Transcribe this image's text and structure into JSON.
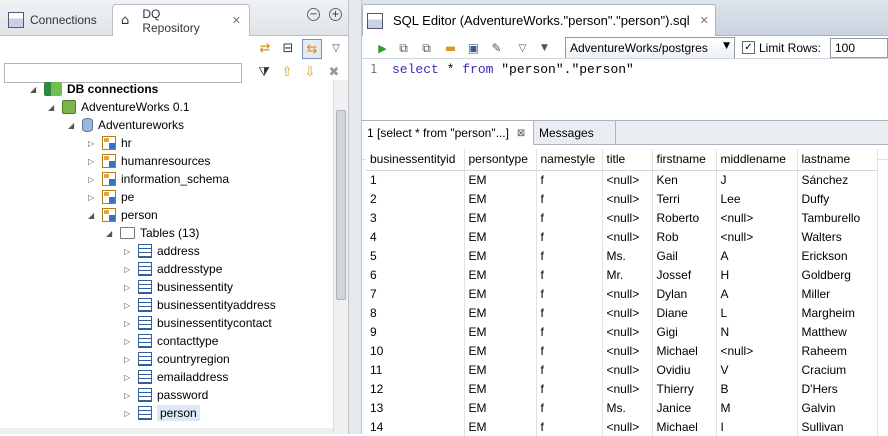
{
  "left_panel": {
    "tabs": [
      {
        "label": "Connections",
        "active": false
      },
      {
        "label": "DQ Repository",
        "active": true
      }
    ],
    "tree": [
      {
        "label": "DB connections",
        "level": 0,
        "icon": "db-connections-icon",
        "expanded": true,
        "bold": true
      },
      {
        "label": "AdventureWorks 0.1",
        "level": 1,
        "icon": "connection-icon",
        "expanded": true
      },
      {
        "label": "Adventureworks",
        "level": 2,
        "icon": "database-icon",
        "expanded": true
      },
      {
        "label": "hr",
        "level": 3,
        "icon": "schema-icon",
        "expanded": false
      },
      {
        "label": "humanresources",
        "level": 3,
        "icon": "schema-icon",
        "expanded": false
      },
      {
        "label": "information_schema",
        "level": 3,
        "icon": "schema-icon",
        "expanded": false
      },
      {
        "label": "pe",
        "level": 3,
        "icon": "schema-icon",
        "expanded": false
      },
      {
        "label": "person",
        "level": 3,
        "icon": "schema-icon",
        "expanded": true
      },
      {
        "label": "Tables (13)",
        "level": 4,
        "icon": "folder-icon",
        "expanded": true
      },
      {
        "label": "address",
        "level": 5,
        "icon": "table-icon",
        "expanded": false
      },
      {
        "label": "addresstype",
        "level": 5,
        "icon": "table-icon",
        "expanded": false
      },
      {
        "label": "businessentity",
        "level": 5,
        "icon": "table-icon",
        "expanded": false
      },
      {
        "label": "businessentityaddress",
        "level": 5,
        "icon": "table-icon",
        "expanded": false
      },
      {
        "label": "businessentitycontact",
        "level": 5,
        "icon": "table-icon",
        "expanded": false
      },
      {
        "label": "contacttype",
        "level": 5,
        "icon": "table-icon",
        "expanded": false
      },
      {
        "label": "countryregion",
        "level": 5,
        "icon": "table-icon",
        "expanded": false
      },
      {
        "label": "emailaddress",
        "level": 5,
        "icon": "table-icon",
        "expanded": false
      },
      {
        "label": "password",
        "level": 5,
        "icon": "table-icon",
        "expanded": false
      },
      {
        "label": "person",
        "level": 5,
        "icon": "table-icon",
        "expanded": false,
        "selected": true
      }
    ]
  },
  "editor": {
    "tab_title": "SQL Editor (AdventureWorks.\"person\".\"person\").sql",
    "connection": "AdventureWorks/postgres",
    "limit_rows_label": "Limit Rows:",
    "limit_rows_checked": true,
    "limit_rows_value": "100",
    "line_number": "1",
    "sql_keyword1": "select",
    "sql_mid": " * ",
    "sql_keyword2": "from",
    "sql_rest": " \"person\".\"person\""
  },
  "results": {
    "tabs": [
      {
        "label": "1 [select * from \"person\"...]",
        "active": true
      },
      {
        "label": "Messages",
        "active": false
      }
    ],
    "columns": [
      "businessentityid",
      "persontype",
      "namestyle",
      "title",
      "firstname",
      "middlename",
      "lastname"
    ],
    "rows": [
      [
        "1",
        "EM",
        "f",
        "<null>",
        "Ken",
        "J",
        "Sánchez"
      ],
      [
        "2",
        "EM",
        "f",
        "<null>",
        "Terri",
        "Lee",
        "Duffy"
      ],
      [
        "3",
        "EM",
        "f",
        "<null>",
        "Roberto",
        "<null>",
        "Tamburello"
      ],
      [
        "4",
        "EM",
        "f",
        "<null>",
        "Rob",
        "<null>",
        "Walters"
      ],
      [
        "5",
        "EM",
        "f",
        "Ms.",
        "Gail",
        "A",
        "Erickson"
      ],
      [
        "6",
        "EM",
        "f",
        "Mr.",
        "Jossef",
        "H",
        "Goldberg"
      ],
      [
        "7",
        "EM",
        "f",
        "<null>",
        "Dylan",
        "A",
        "Miller"
      ],
      [
        "8",
        "EM",
        "f",
        "<null>",
        "Diane",
        "L",
        "Margheim"
      ],
      [
        "9",
        "EM",
        "f",
        "<null>",
        "Gigi",
        "N",
        "Matthew"
      ],
      [
        "10",
        "EM",
        "f",
        "<null>",
        "Michael",
        "<null>",
        "Raheem"
      ],
      [
        "11",
        "EM",
        "f",
        "<null>",
        "Ovidiu",
        "V",
        "Cracium"
      ],
      [
        "12",
        "EM",
        "f",
        "<null>",
        "Thierry",
        "B",
        "D'Hers"
      ],
      [
        "13",
        "EM",
        "f",
        "Ms.",
        "Janice",
        "M",
        "Galvin"
      ],
      [
        "14",
        "EM",
        "f",
        "<null>",
        "Michael",
        "I",
        "Sullivan"
      ]
    ]
  }
}
